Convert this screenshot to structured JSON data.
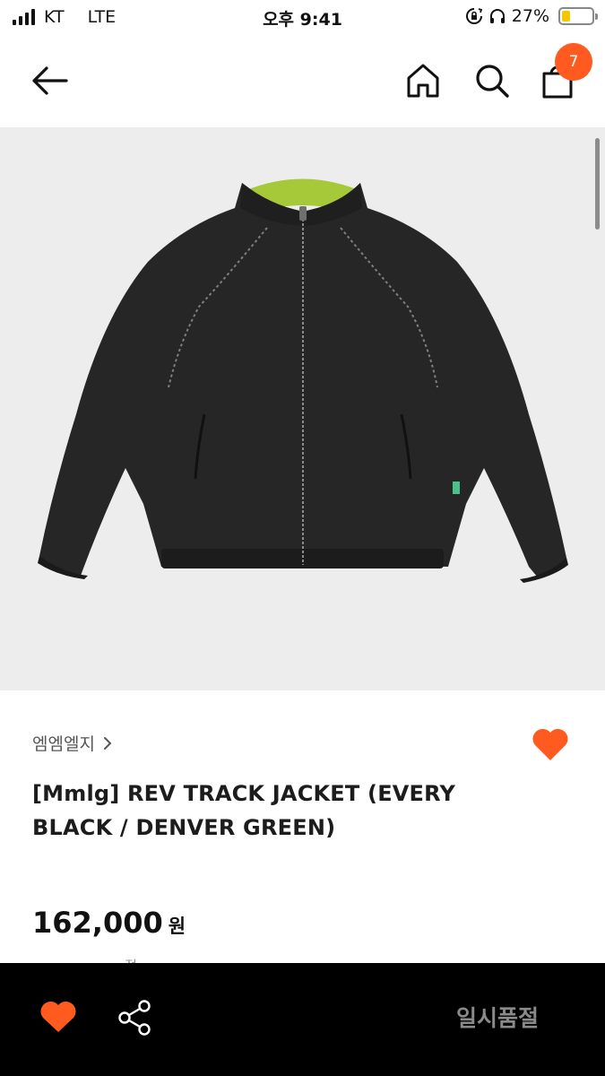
{
  "status_bar": {
    "carrier": "KT",
    "network": "LTE",
    "time": "오후 9:41",
    "battery_percent": "27%",
    "battery_level": 0.27,
    "icons": [
      "signal-icon",
      "screen-lock-rotation-icon",
      "headphones-icon",
      "battery-icon"
    ]
  },
  "nav": {
    "icons": [
      "back-arrow-icon",
      "home-icon",
      "search-icon",
      "shopping-bag-icon"
    ],
    "cart_count": "7"
  },
  "product": {
    "brand": "엠엠엘지",
    "title": "[Mmlg] REV TRACK JACKET (EVERY BLACK / DENVER GREEN)",
    "price": "162,000",
    "price_unit": "원",
    "liked": true,
    "image_icon": "jacket-photo",
    "peek_text": "... 정"
  },
  "bottom_bar": {
    "icons": [
      "heart-icon",
      "share-icon"
    ],
    "status_label": "일시품절"
  },
  "colors": {
    "accent": "#ff5a1f",
    "image_background": "#ededed",
    "bottom_bar_background": "#000000",
    "sold_out_text": "#8a8a8a"
  }
}
